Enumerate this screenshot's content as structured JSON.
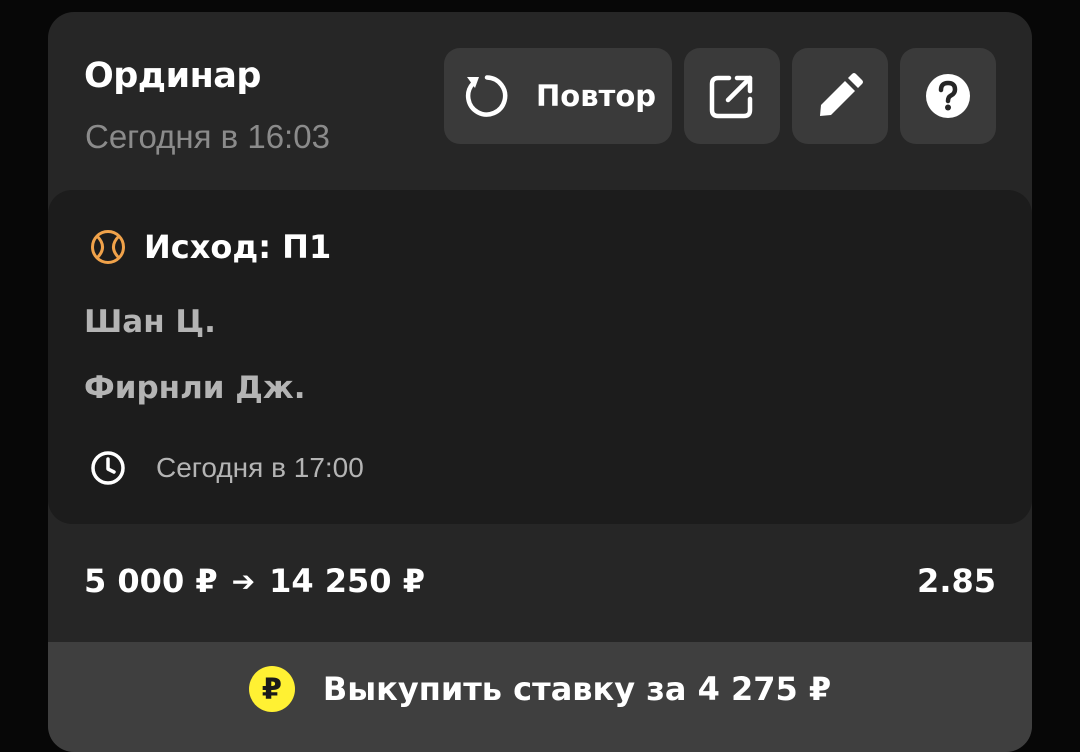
{
  "bet": {
    "type": "Ординар",
    "placed_at": "Сегодня в 16:03"
  },
  "actions": {
    "repeat_label": "Повтор",
    "repeat_icon": "refresh-icon",
    "share_icon": "external-link-icon",
    "edit_icon": "pencil-icon",
    "help_icon": "question-icon"
  },
  "event": {
    "sport_icon": "tennis-ball-icon",
    "outcome": "Исход: П1",
    "team_1": "Шан Ц.",
    "team_2": "Фирнли Дж.",
    "start_icon": "clock-icon",
    "start_time": "Сегодня в 17:00"
  },
  "stake": {
    "amount": "5 000 ₽",
    "arrow": "➔",
    "payout": "14 250 ₽",
    "coefficient": "2.85"
  },
  "cashout": {
    "coin_symbol": "₽",
    "label": "Выкупить ставку за 4 275 ₽"
  },
  "colors": {
    "background": "#070707",
    "card": "#262626",
    "inner_card": "#1c1c1c",
    "button": "#3a3a3a",
    "cashout_bar": "#3f3f3f",
    "accent_yellow": "#fff133",
    "sport_icon_orange": "#f0a24a",
    "muted_text": "#8b8b8b"
  }
}
